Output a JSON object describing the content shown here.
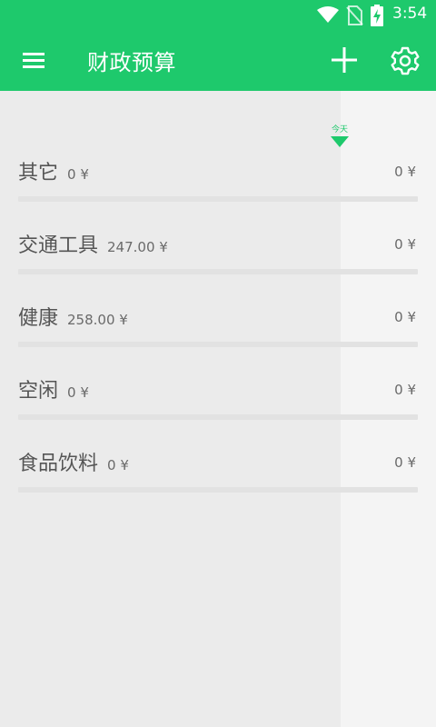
{
  "status_bar": {
    "time": "3:54",
    "icons": [
      "wifi-icon",
      "no-sim-icon",
      "battery-charging-icon"
    ]
  },
  "app_bar": {
    "title": "财政预算",
    "icons": [
      "menu-icon",
      "add-icon",
      "settings-icon"
    ]
  },
  "timeline": {
    "today_label": "今天"
  },
  "categories": [
    {
      "name": "其它",
      "spent": "0 ¥",
      "budget": "0 ¥"
    },
    {
      "name": "交通工具",
      "spent": "247.00 ¥",
      "budget": "0 ¥"
    },
    {
      "name": "健康",
      "spent": "258.00 ¥",
      "budget": "0 ¥"
    },
    {
      "name": "空闲",
      "spent": "0 ¥",
      "budget": "0 ¥"
    },
    {
      "name": "食品饮料",
      "spent": "0 ¥",
      "budget": "0 ¥"
    }
  ],
  "colors": {
    "accent": "#1ec96c",
    "elapsed_background": "#ebebeb",
    "background": "#f4f4f4"
  }
}
